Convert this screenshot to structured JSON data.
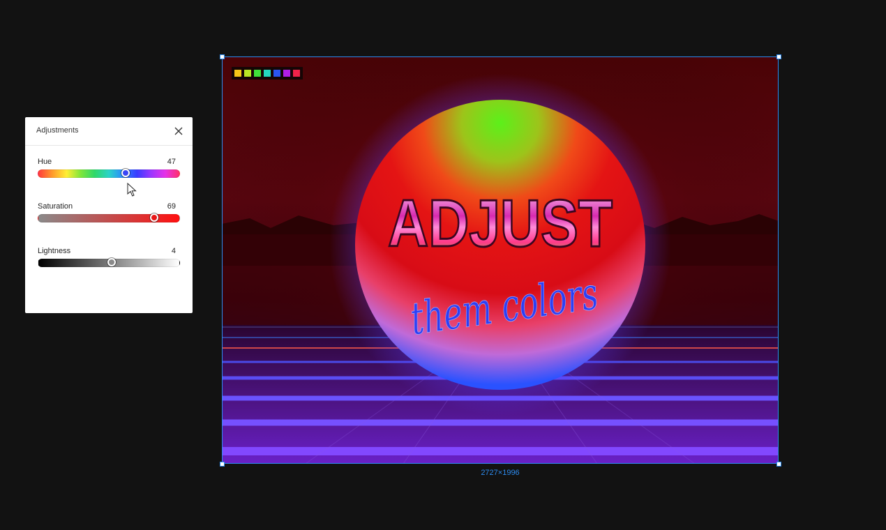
{
  "panel": {
    "title": "Adjustments",
    "close_icon": "close-icon",
    "hue": {
      "label": "Hue",
      "value": "47",
      "position": 0.62
    },
    "saturation": {
      "label": "Saturation",
      "value": "69",
      "position": 0.82
    },
    "lightness": {
      "label": "Lightness",
      "value": "4",
      "position": 0.52
    }
  },
  "palette": [
    "#f5c518",
    "#b8e625",
    "#3fe23a",
    "#24d8c0",
    "#2a55f0",
    "#b21ee8",
    "#f0234a"
  ],
  "artwork": {
    "headline": "ADJUST",
    "script_text": "them colors"
  },
  "canvas": {
    "dimensions": "2727×1996"
  }
}
